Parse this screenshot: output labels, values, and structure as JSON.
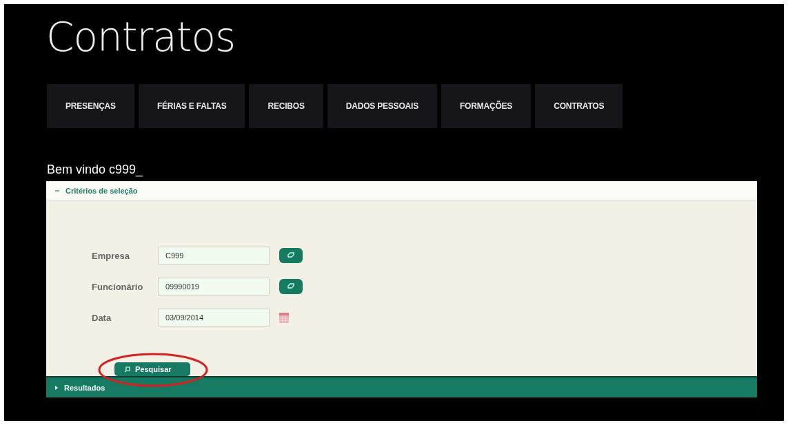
{
  "page_title": "Contratos",
  "tabs": [
    {
      "label": "PRESENÇAS"
    },
    {
      "label": "FÉRIAS E FALTAS"
    },
    {
      "label": "RECIBOS"
    },
    {
      "label": "DADOS PESSOAIS"
    },
    {
      "label": "FORMAÇÕES"
    },
    {
      "label": "CONTRATOS"
    }
  ],
  "welcome": "Bem vindo c999_",
  "criteria": {
    "title": "Critérios de seleção",
    "expanded": true,
    "fields": [
      {
        "label": "Empresa",
        "value": "C999",
        "kind": "lookup"
      },
      {
        "label": "Funcionário",
        "value": "09990019",
        "kind": "lookup"
      },
      {
        "label": "Data",
        "value": "03/09/2014",
        "kind": "date"
      }
    ],
    "search_button": "Pesquisar",
    "highlighted": true
  },
  "results": {
    "title": "Resultados",
    "expanded": false
  }
}
